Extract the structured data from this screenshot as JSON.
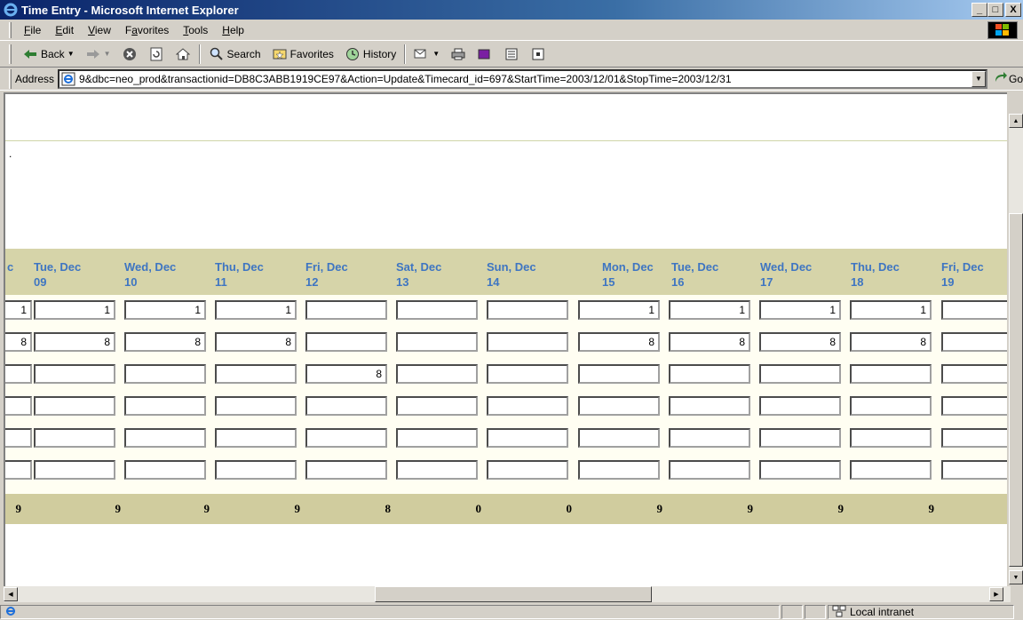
{
  "window": {
    "title": "Time Entry - Microsoft Internet Explorer",
    "controls": {
      "minimize": "_",
      "maximize": "□",
      "close": "X"
    }
  },
  "menu": [
    "File",
    "Edit",
    "View",
    "Favorites",
    "Tools",
    "Help"
  ],
  "toolbar": {
    "back": "Back",
    "search": "Search",
    "favorites": "Favorites",
    "history": "History"
  },
  "address": {
    "label": "Address",
    "url": "9&dbc=neo_prod&transactionid=DB8C3ABB1919CE97&Action=Update&Timecard_id=697&StartTime=2003/12/01&StopTime=2003/12/31",
    "go": "Go"
  },
  "page": {
    "dot": "."
  },
  "timesheet": {
    "partial_header": "c",
    "days": [
      {
        "name": "Tue, Dec",
        "date": "09"
      },
      {
        "name": "Wed, Dec",
        "date": "10"
      },
      {
        "name": "Thu, Dec",
        "date": "11"
      },
      {
        "name": "Fri, Dec",
        "date": "12"
      },
      {
        "name": "Sat, Dec",
        "date": "13"
      },
      {
        "name": "Sun, Dec",
        "date": "14"
      },
      {
        "name": "Mon, Dec",
        "date": "15"
      },
      {
        "name": "Tue, Dec",
        "date": "16"
      },
      {
        "name": "Wed, Dec",
        "date": "17"
      },
      {
        "name": "Thu, Dec",
        "date": "18"
      },
      {
        "name": "Fri, Dec",
        "date": "19"
      }
    ],
    "rows": [
      [
        "1",
        "1",
        "1",
        "1",
        "",
        "",
        "",
        "1",
        "1",
        "1",
        "1",
        ""
      ],
      [
        "8",
        "8",
        "8",
        "8",
        "",
        "",
        "",
        "8",
        "8",
        "8",
        "8",
        ""
      ],
      [
        "",
        "",
        "",
        "",
        "8",
        "",
        "",
        "",
        "",
        "",
        "",
        ""
      ],
      [
        "",
        "",
        "",
        "",
        "",
        "",
        "",
        "",
        "",
        "",
        "",
        ""
      ],
      [
        "",
        "",
        "",
        "",
        "",
        "",
        "",
        "",
        "",
        "",
        "",
        ""
      ],
      [
        "",
        "",
        "",
        "",
        "",
        "",
        "",
        "",
        "",
        "",
        "",
        ""
      ]
    ],
    "totals": [
      "9",
      "9",
      "9",
      "9",
      "8",
      "0",
      "0",
      "9",
      "9",
      "9",
      "9"
    ]
  },
  "status": {
    "zone": "Local intranet"
  }
}
